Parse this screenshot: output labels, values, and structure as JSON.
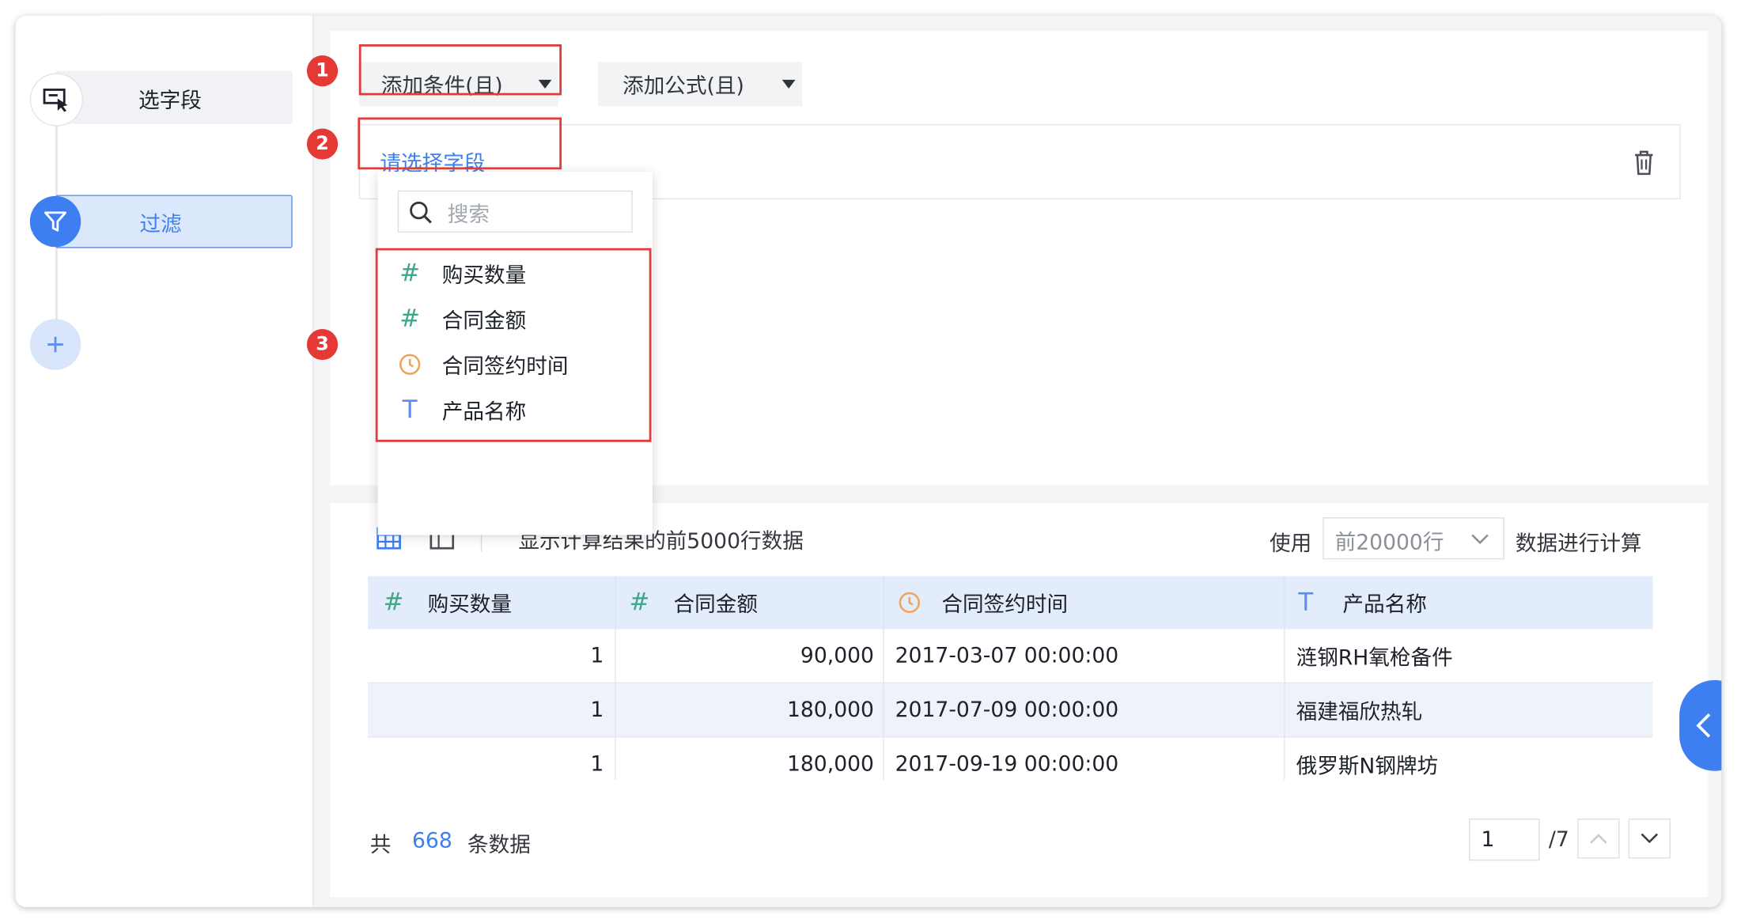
{
  "steps": [
    {
      "label": "选字段",
      "icon": "select-field-icon"
    },
    {
      "label": "过滤",
      "icon": "filter-icon"
    },
    {
      "label": "",
      "icon": "plus-icon"
    }
  ],
  "toolbar": {
    "add_condition": "添加条件(且)",
    "add_formula": "添加公式(且)"
  },
  "condition": {
    "field_placeholder": "请选择字段"
  },
  "badges": [
    "1",
    "2",
    "3"
  ],
  "dropdown": {
    "search_placeholder": "搜索",
    "items": [
      {
        "label": "购买数量",
        "type": "number",
        "icon": "#"
      },
      {
        "label": "合同金额",
        "type": "number",
        "icon": "#"
      },
      {
        "label": "合同签约时间",
        "type": "date",
        "icon": "clock"
      },
      {
        "label": "产品名称",
        "type": "text",
        "icon": "T"
      }
    ]
  },
  "preview": {
    "info": "显示计算结果的前5000行数据",
    "use_label": "使用",
    "rows_option": "前20000行",
    "calc_label": "数据进行计算"
  },
  "table": {
    "columns": [
      {
        "label": "购买数量",
        "type": "number",
        "icon": "#"
      },
      {
        "label": "合同金额",
        "type": "number",
        "icon": "#"
      },
      {
        "label": "合同签约时间",
        "type": "date",
        "icon": "clock"
      },
      {
        "label": "产品名称",
        "type": "text",
        "icon": "T"
      }
    ],
    "rows": [
      [
        "1",
        "90,000",
        "2017-03-07 00:00:00",
        "涟钢RH氧枪备件"
      ],
      [
        "1",
        "180,000",
        "2017-07-09 00:00:00",
        "福建福欣热轧"
      ],
      [
        "1",
        "180,000",
        "2017-09-19 00:00:00",
        "俄罗斯N钢牌坊"
      ]
    ]
  },
  "footer": {
    "total_prefix": "共",
    "total_count": "668",
    "total_suffix": "条数据",
    "page_value": "1",
    "page_total": "/7"
  },
  "colors": {
    "accent": "#3d7ff0",
    "red": "#e53935",
    "number_icon": "#3fa68a",
    "date_icon": "#f0a35a",
    "text_icon": "#5b8df0"
  }
}
